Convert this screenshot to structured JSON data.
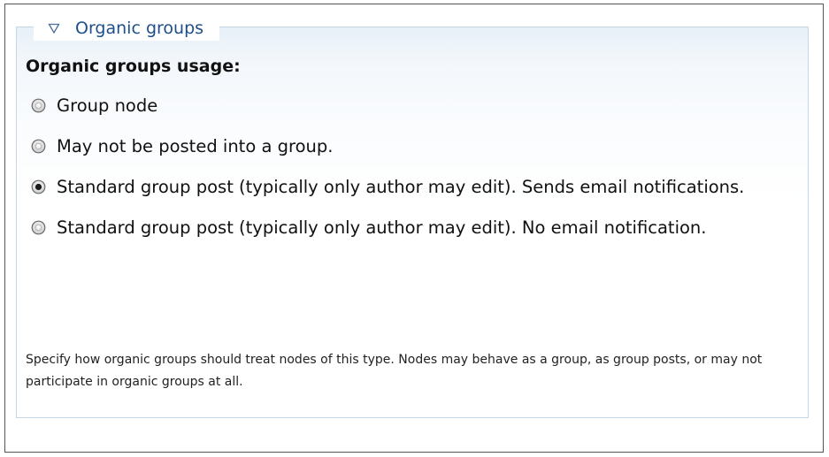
{
  "fieldset": {
    "legend": "Organic groups",
    "toggle_icon": "triangle-down-icon",
    "border_color": "#c5d6e6",
    "legend_color": "#1e4f8a"
  },
  "field": {
    "label": "Organic groups usage:",
    "options": [
      {
        "label": "Group node",
        "checked": false
      },
      {
        "label": "May not be posted into a group.",
        "checked": false
      },
      {
        "label": "Standard group post (typically only author may edit). Sends email notifications.",
        "checked": true
      },
      {
        "label": "Standard group post (typically only author may edit). No email notification.",
        "checked": false
      }
    ],
    "description": "Specify how organic groups should treat nodes of this type. Nodes may behave as a group, as group posts, or may not participate in organic groups at all."
  }
}
